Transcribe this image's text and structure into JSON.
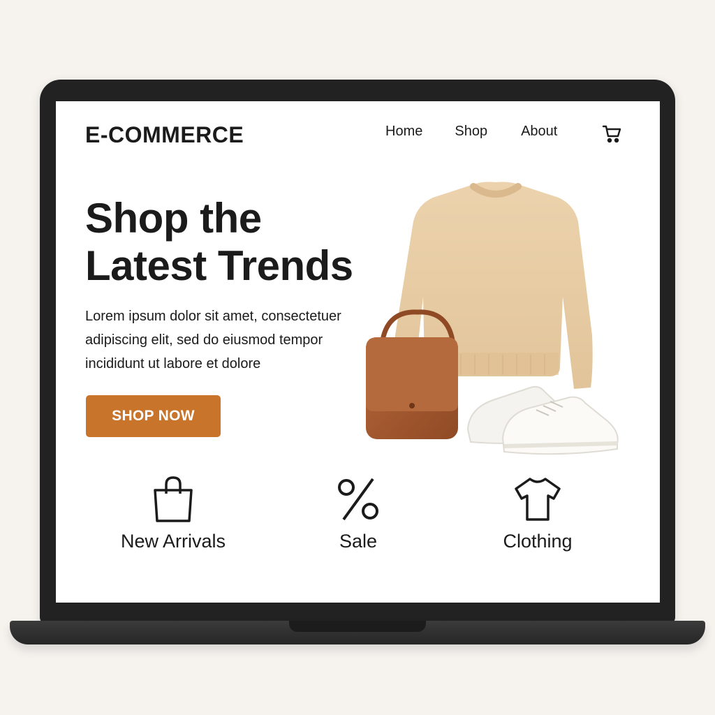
{
  "header": {
    "logo": "E-COMMERCE",
    "nav": [
      "Home",
      "Shop",
      "About"
    ],
    "cart_icon": "cart-icon"
  },
  "hero": {
    "title_line1": "Shop the",
    "title_line2": "Latest Trends",
    "description": "Lorem ipsum dolor sit amet, consectetuer adipiscing elit, sed do eiusmod tempor incididunt ut labore et dolore",
    "cta_label": "SHOP NOW",
    "cta_color": "#c8742a",
    "products": [
      "sweater",
      "handbag",
      "sneakers"
    ]
  },
  "categories": [
    {
      "label": "New Arrivals",
      "icon": "shopping-bag-icon"
    },
    {
      "label": "Sale",
      "icon": "percent-icon"
    },
    {
      "label": "Clothing",
      "icon": "tshirt-icon"
    }
  ],
  "colors": {
    "background": "#f6f3ef",
    "laptop": "#222222",
    "text": "#1b1b1b"
  }
}
